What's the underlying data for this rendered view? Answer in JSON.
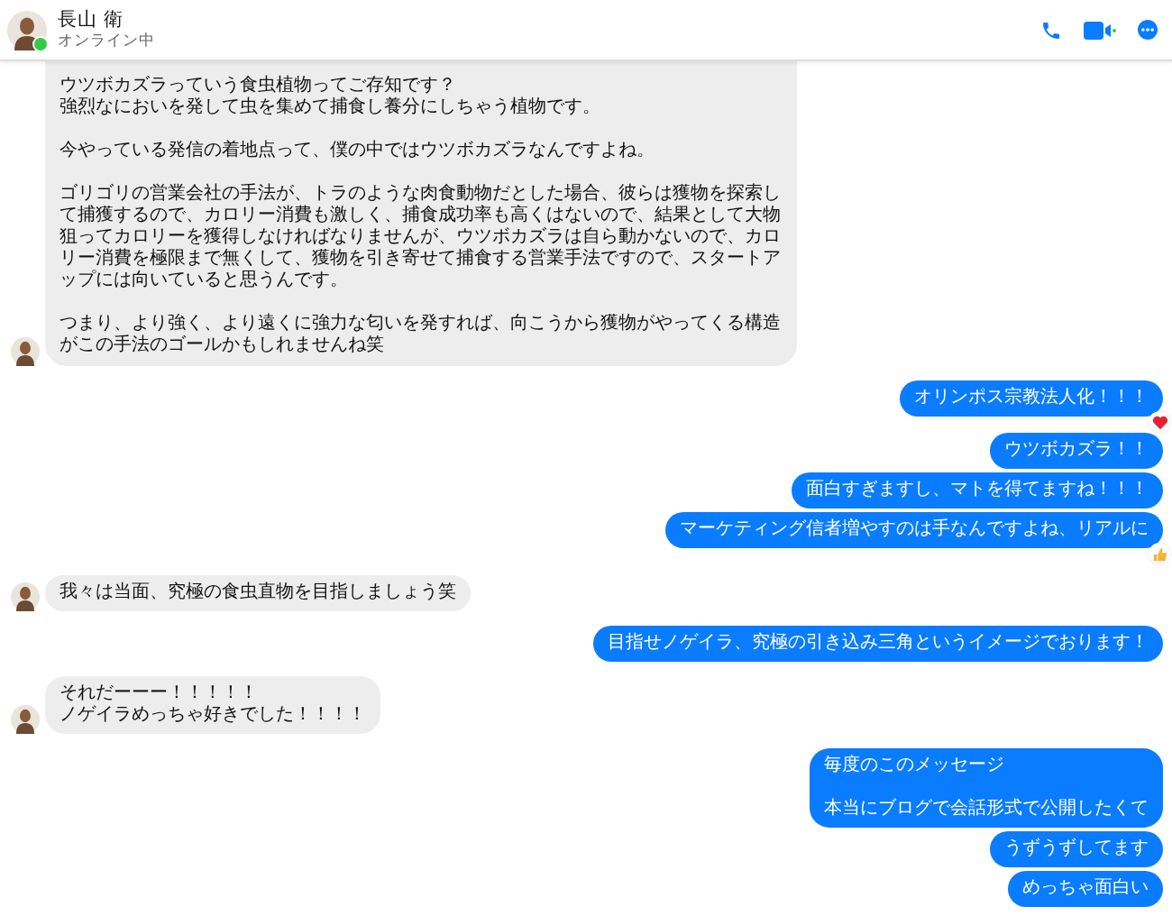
{
  "header": {
    "name": "長山 衛",
    "status": "オンライン中",
    "online": true
  },
  "messages": [
    {
      "kind": "incoming",
      "paragraphs": [
        [
          "ウツボカズラっていう食虫植物ってご存知です？",
          "強烈なにおいを発して虫を集めて捕食し養分にしちゃう植物です。"
        ],
        [
          "今やっている発信の着地点って、僕の中ではウツボカズラなんですよね。"
        ],
        [
          "ゴリゴリの営業会社の手法が、トラのような肉食動物だとした場合、彼らは獲物を探索して捕獲するので、カロリー消費も激しく、捕食成功率も高くはないので、結果として大物狙ってカロリーを獲得しなければなりませんが、ウツボカズラは自ら動かないので、カロリー消費を極限まで無くして、獲物を引き寄せて捕食する営業手法ですので、スタートアップには向いていると思うんです。"
        ],
        [
          "つまり、より強く、より遠くに強力な匂いを発すれば、向こうから獲物がやってくる構造がこの手法のゴールかもしれませんね笑"
        ]
      ]
    },
    {
      "kind": "outgoing",
      "paragraphs": [
        [
          "オリンポス宗教法人化！！！"
        ]
      ],
      "reaction": {
        "kind": "heart"
      }
    },
    {
      "kind": "outgoing",
      "paragraphs": [
        [
          "ウツボカズラ！！"
        ]
      ]
    },
    {
      "kind": "outgoing",
      "paragraphs": [
        [
          "面白すぎますし、マトを得てますね！！！"
        ]
      ]
    },
    {
      "kind": "outgoing",
      "paragraphs": [
        [
          "マーケティング信者増やすのは手なんですよね、リアルに"
        ]
      ],
      "reaction": {
        "kind": "thumb"
      }
    },
    {
      "kind": "incoming",
      "paragraphs": [
        [
          "我々は当面、究極の食虫直物を目指しましょう笑"
        ]
      ]
    },
    {
      "kind": "outgoing",
      "paragraphs": [
        [
          "目指せノゲイラ、究極の引き込み三角というイメージでおります！"
        ]
      ]
    },
    {
      "kind": "incoming",
      "paragraphs": [
        [
          "それだーーー！！！！！",
          "ノゲイラめっちゃ好きでした！！！！"
        ]
      ]
    },
    {
      "kind": "outgoing",
      "paragraphs": [
        [
          "毎度のこのメッセージ"
        ],
        [
          "本当にブログで会話形式で公開したくて"
        ]
      ]
    },
    {
      "kind": "outgoing",
      "paragraphs": [
        [
          "うずうずしてます"
        ]
      ]
    },
    {
      "kind": "outgoing",
      "paragraphs": [
        [
          "めっちゃ面白い"
        ]
      ]
    }
  ]
}
